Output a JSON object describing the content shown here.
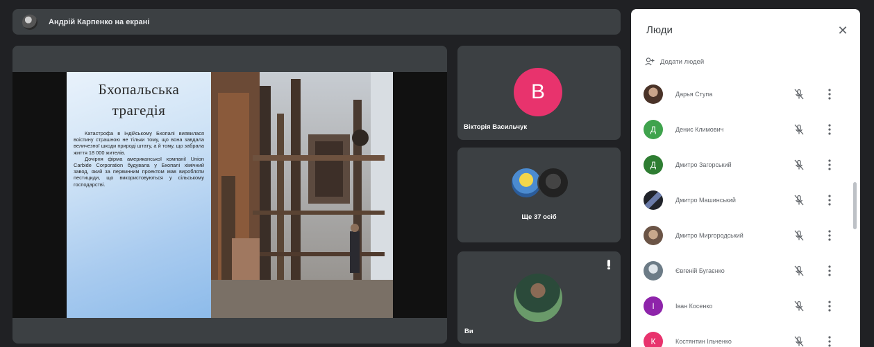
{
  "presenter_bar": {
    "text": "Андрій Карпенко на екрані"
  },
  "slide": {
    "title": "Бхопальська трагедія",
    "paragraph1": "Катастрофа в індійському Бхопалі виявилася воістину страшною не тільки тому, що вона завдала величезної шкоди природі штату, а й тому, що забрала життя 18 000 жителів.",
    "paragraph2": "Дочірня фірма американської компанії Union Carbide Corporation будувала у Бхопалі хімічний завод, який за первинним проектом мав виробляти пестициди, що використовуються у сільському господарстві."
  },
  "tiles": {
    "viktoria": {
      "initial": "B",
      "name": "Вікторія Васильчук",
      "color": "#e8336d"
    },
    "others": {
      "label": "Ще 37 осіб"
    },
    "self": {
      "name": "Ви"
    }
  },
  "people_panel": {
    "title": "Люди",
    "add_people": "Додати людей",
    "participants": [
      {
        "name": "Дарья Ступа",
        "initial": "",
        "color": "#6d4c41"
      },
      {
        "name": "Денис Климович",
        "initial": "Д",
        "color": "#3fa34d"
      },
      {
        "name": "Дмитро Загорський",
        "initial": "Д",
        "color": "#2e7d32"
      },
      {
        "name": "Дмитро Машинський",
        "initial": "",
        "color": "#37474f"
      },
      {
        "name": "Дмитро Миргородський",
        "initial": "",
        "color": "#8d6e63"
      },
      {
        "name": "Євгеній Бугаєнко",
        "initial": "",
        "color": "#78909c"
      },
      {
        "name": "Іван Косенко",
        "initial": "І",
        "color": "#8e24aa"
      },
      {
        "name": "Костянтин Ільченко",
        "initial": "К",
        "color": "#e8336d"
      }
    ]
  }
}
